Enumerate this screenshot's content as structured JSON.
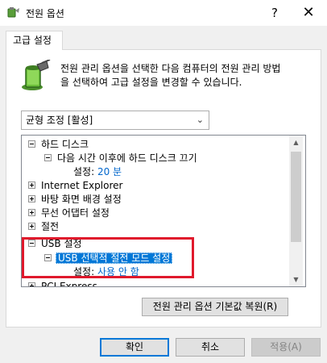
{
  "window": {
    "title": "전원 옵션",
    "help_glyph": "?",
    "close_glyph": "✕"
  },
  "tab": {
    "label": "고급 설정"
  },
  "description": {
    "line1": "전원 관리 옵션을 선택한 다음 컴퓨터의 전원 관리 방법",
    "line2": "을 선택하여 고급 설정을 변경할 수 있습니다."
  },
  "scheme_select": {
    "value": "균형 조정 [활성]"
  },
  "tree": {
    "items": [
      {
        "label": "하드 디스크",
        "expander": "minus"
      },
      {
        "label": "다음 시간 이후에 하드 디스크 끄기",
        "expander": "minus"
      },
      {
        "setting_label": "설정:",
        "setting_value": "20 분"
      },
      {
        "label": "Internet Explorer",
        "expander": "plus"
      },
      {
        "label": "바탕 화면 배경 설정",
        "expander": "plus"
      },
      {
        "label": "무선 어댑터 설정",
        "expander": "plus"
      },
      {
        "label": "절전",
        "expander": "plus"
      },
      {
        "label": "USB 설정",
        "expander": "minus"
      },
      {
        "label": "USB 선택적 절전 모드 설정",
        "expander": "minus",
        "selected": true
      },
      {
        "setting_label": "설정:",
        "setting_value": "사용 안 함"
      },
      {
        "label": "PCI Express",
        "expander": "plus"
      }
    ]
  },
  "buttons": {
    "restore_defaults": "전원 관리 옵션 기본값 복원(R)",
    "ok": "확인",
    "cancel": "취소",
    "apply": "적용(A)"
  },
  "colors": {
    "accent": "#0078d7",
    "highlight_border": "#e0192c",
    "setting_value": "#0066cc"
  }
}
